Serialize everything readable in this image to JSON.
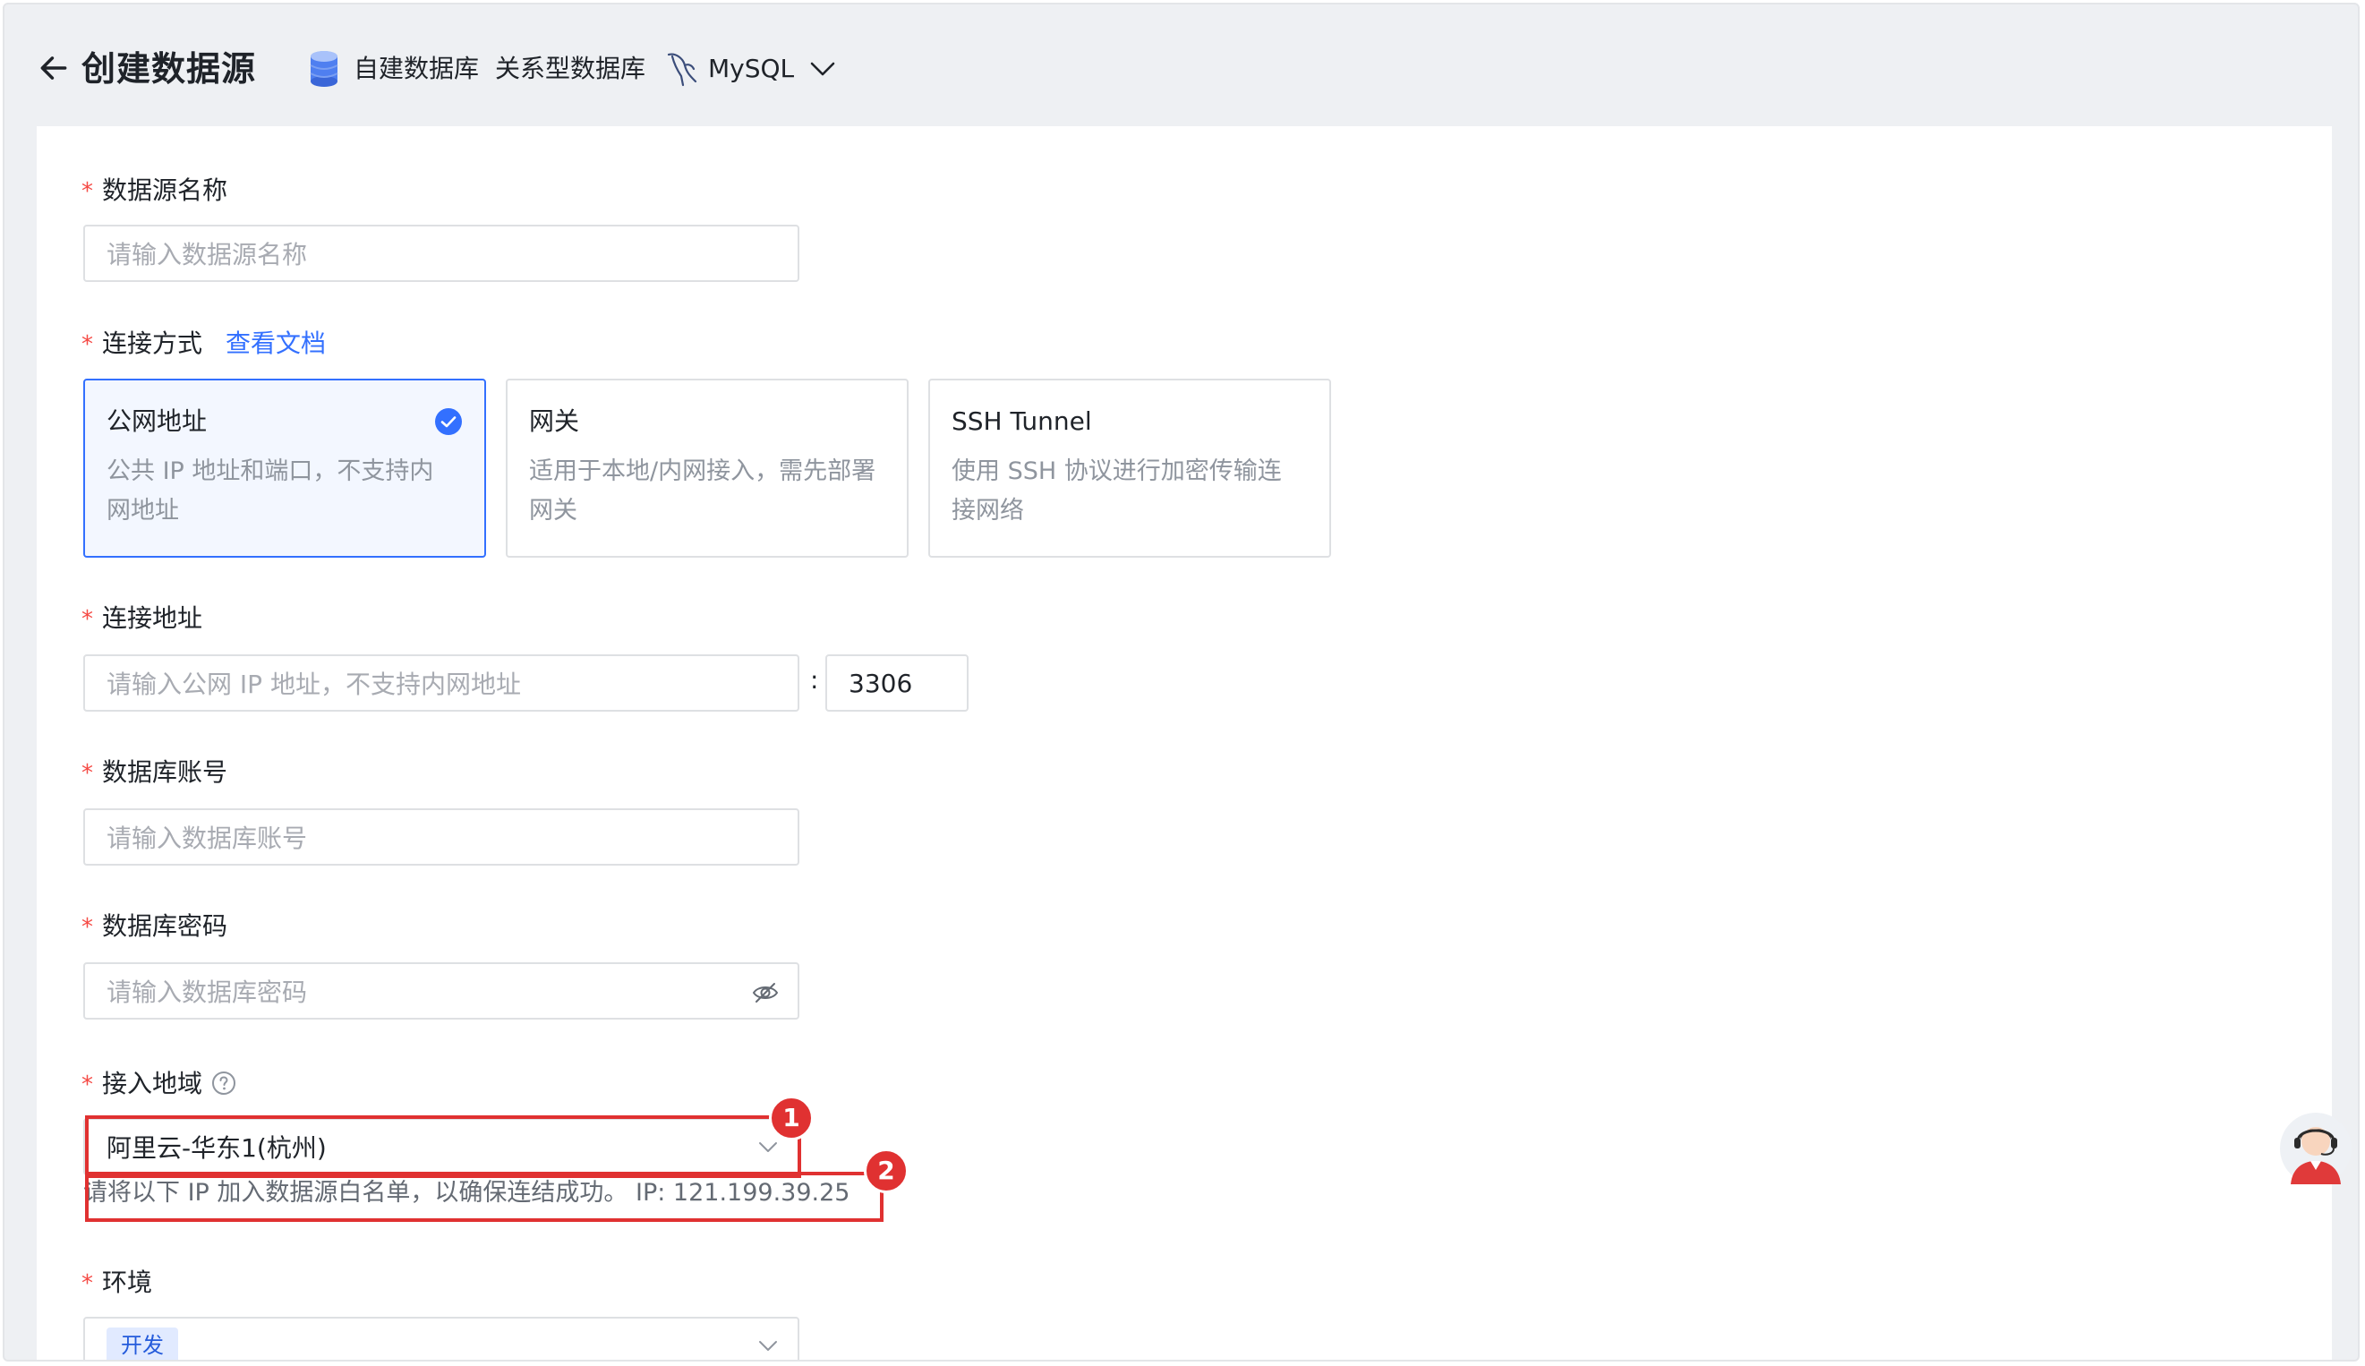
{
  "header": {
    "title": "创建数据源",
    "breadcrumbs": [
      "自建数据库",
      "关系型数据库",
      "MySQL"
    ],
    "icons": [
      "back-arrow-icon",
      "database-icon",
      "mysql-dolphin-icon",
      "chevron-down-icon"
    ]
  },
  "form": {
    "name": {
      "label": "数据源名称",
      "placeholder": "请输入数据源名称"
    },
    "connection": {
      "label": "连接方式",
      "doc_link": "查看文档",
      "options": [
        {
          "title": "公网地址",
          "desc": "公共 IP 地址和端口，不支持内网地址",
          "selected": true
        },
        {
          "title": "网关",
          "desc": "适用于本地/内网接入，需先部署网关",
          "selected": false
        },
        {
          "title": "SSH Tunnel",
          "desc": "使用 SSH 协议进行加密传输连接网络",
          "selected": false
        }
      ]
    },
    "address": {
      "label": "连接地址",
      "placeholder": "请输入公网 IP 地址，不支持内网地址",
      "port_separator": ":",
      "port": "3306"
    },
    "account": {
      "label": "数据库账号",
      "placeholder": "请输入数据库账号"
    },
    "password": {
      "label": "数据库密码",
      "placeholder": "请输入数据库密码"
    },
    "region": {
      "label": "接入地域",
      "value": "阿里云-华东1(杭州)",
      "hint": "请将以下 IP 加入数据源白名单，以确保连结成功。 IP: 121.199.39.25"
    },
    "environment": {
      "label": "环境",
      "value": "开发"
    },
    "required_mark": "*"
  },
  "annotations": {
    "badge_1": "1",
    "badge_2": "2",
    "color": "#e03131"
  },
  "colors": {
    "accent": "#3370ff",
    "required": "#f54a45",
    "border": "#dee0e3"
  }
}
